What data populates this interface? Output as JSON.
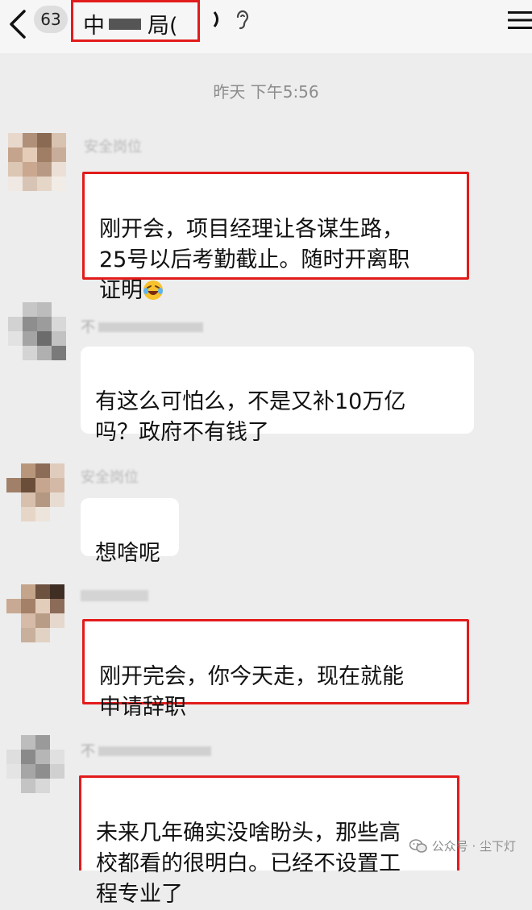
{
  "header": {
    "unread_count": "63",
    "title_start": "中",
    "title_end": "局(",
    "back_icon": "chevron-left-icon",
    "menu_icon": "hamburger-menu-icon"
  },
  "timestamp": "昨天 下午5:56",
  "messages": [
    {
      "sender": "安全岗位",
      "text": "刚开会，项目经理让各谋生路，\n25号以后考勤截止。随时开离职\n证明",
      "emoji": "laughing-crying-emoji",
      "highlighted": true
    },
    {
      "sender": "不",
      "text": "有这么可怕么，不是又补10万亿\n吗？政府不有钱了",
      "highlighted": false
    },
    {
      "sender": "安全岗位",
      "text": "想啥呢",
      "highlighted": false
    },
    {
      "sender": "",
      "text": "刚开完会，你今天走，现在就能\n申请辞职",
      "highlighted": true
    },
    {
      "sender": "不",
      "text": "未来几年确实没啥盼头，那些高\n校都看的很明白。已经不设置工\n程专业了",
      "highlighted": true
    }
  ],
  "watermark": {
    "text": "公众号 · 尘下灯",
    "icon": "wechat-icon"
  },
  "colors": {
    "highlight": "#e21b1b",
    "background": "#ededed",
    "bubble": "#ffffff"
  }
}
